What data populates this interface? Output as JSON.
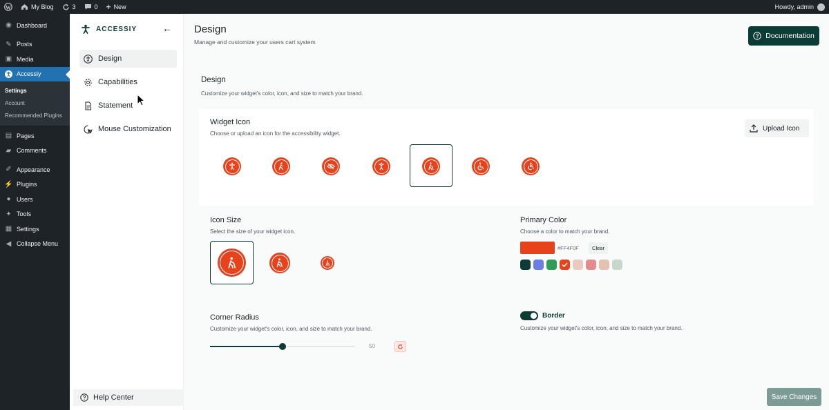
{
  "adminbar": {
    "site": "My Blog",
    "updates": "3",
    "comments": "0",
    "new": "New",
    "howdy": "Howdy, admin"
  },
  "wp_menu": {
    "dashboard": "Dashboard",
    "posts": "Posts",
    "media": "Media",
    "accessiy": "Accessiy",
    "sub_settings": "Settings",
    "sub_account": "Account",
    "sub_recommended": "Recommended Plugins",
    "pages": "Pages",
    "comments": "Comments",
    "appearance": "Appearance",
    "plugins": "Plugins",
    "users": "Users",
    "tools": "Tools",
    "settings": "Settings",
    "collapse": "Collapse Menu"
  },
  "plugin_nav": {
    "brand": "ACCESSIY",
    "design": "Design",
    "capabilities": "Capabilities",
    "statement": "Statement",
    "mouse": "Mouse Customization",
    "help": "Help Center"
  },
  "header": {
    "title": "Design",
    "subtitle": "Manage and customize your users cart system",
    "documentation": "Documentation"
  },
  "section": {
    "title": "Design",
    "subtitle": "Customize your widget's color, icon, and size to match your brand."
  },
  "widget_icon": {
    "title": "Widget Icon",
    "subtitle": "Choose or upload an icon for the accessibility widget.",
    "upload": "Upload Icon"
  },
  "icon_size": {
    "title": "Icon Size",
    "subtitle": "Select the size of your widget icon."
  },
  "primary_color": {
    "title": "Primary Color",
    "subtitle": "Choose a color to match your brand.",
    "hex": "#FF4F0F",
    "clear": "Clear",
    "value": "#e8421d",
    "swatches": [
      "#0d3b36",
      "#6b7fe0",
      "#2e9e57",
      "#e8421d",
      "#e9c9c0",
      "#e58d8d",
      "#e4c2b2",
      "#c7d7c9"
    ]
  },
  "corner_radius": {
    "title": "Corner Radius",
    "subtitle": "Customize your widget's color, icon, and size to match your brand.",
    "value": "50",
    "level": 0.5
  },
  "border": {
    "label": "Border",
    "subtitle": "Customize your widget's color, icon, and size to match your brand.",
    "enabled": true
  },
  "footer": {
    "save": "Save Changes"
  }
}
